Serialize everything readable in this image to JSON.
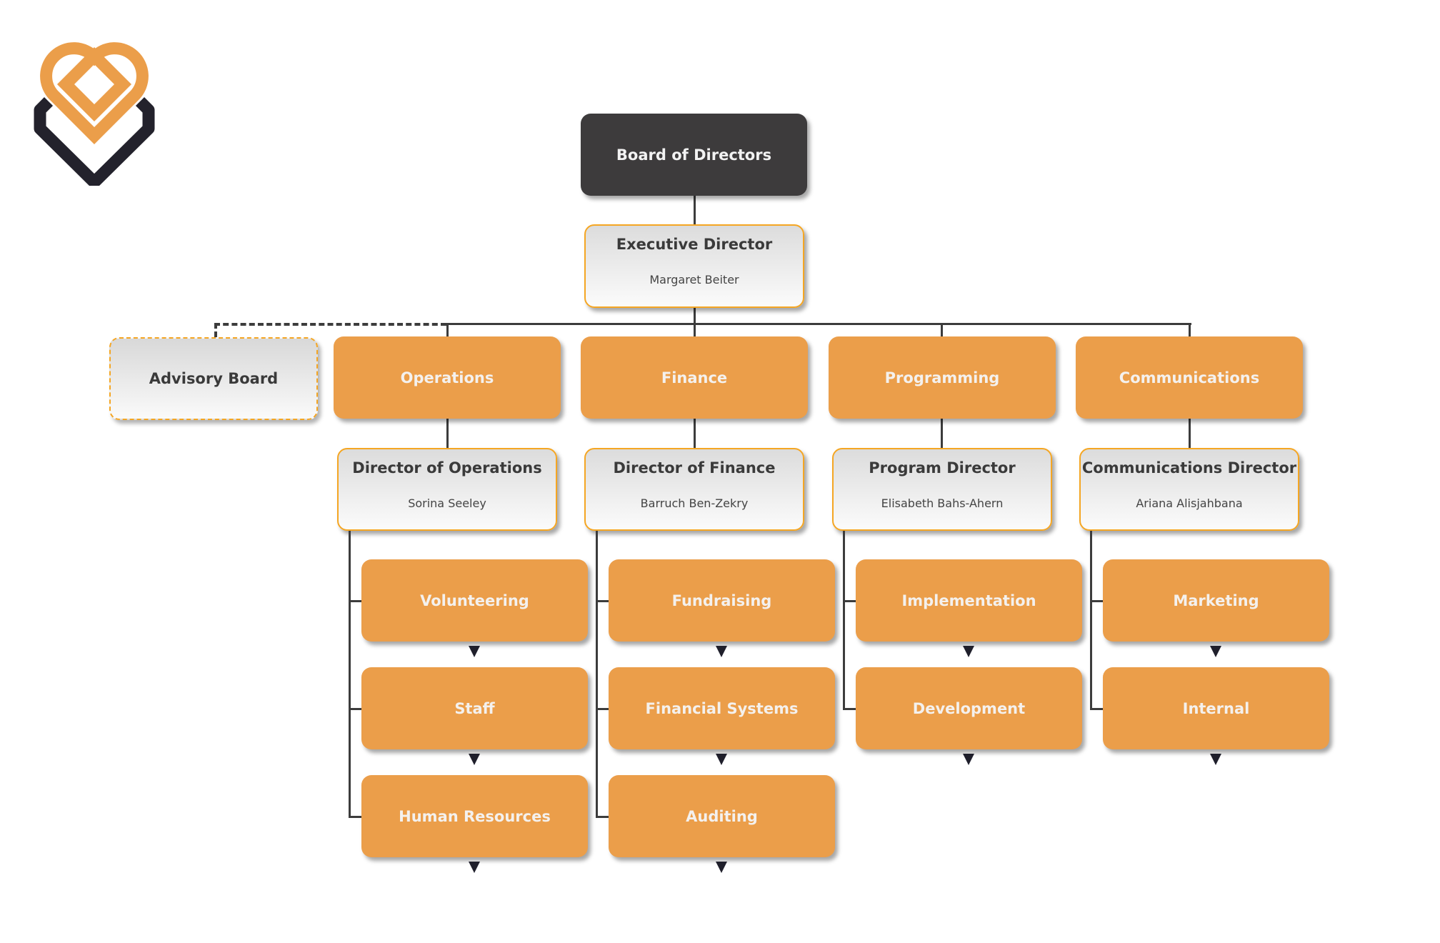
{
  "brand": {
    "logo": "heart-diamond-logo-icon",
    "accent": "#eb9e4a",
    "dark": "#3d3b3c",
    "outline": "#f5a623"
  },
  "board": {
    "label": "Board of Directors"
  },
  "executive": {
    "title": "Executive Director",
    "name": "Margaret Beiter"
  },
  "advisory": {
    "label": "Advisory Board"
  },
  "departments": [
    {
      "label": "Operations",
      "director": {
        "title": "Director of Operations",
        "name": "Sorina Seeley"
      },
      "units": [
        "Volunteering",
        "Staff",
        "Human Resources"
      ]
    },
    {
      "label": "Finance",
      "director": {
        "title": "Director of Finance",
        "name": "Barruch Ben-Zekry"
      },
      "units": [
        "Fundraising",
        "Financial Systems",
        "Auditing"
      ]
    },
    {
      "label": "Programming",
      "director": {
        "title": "Program Director",
        "name": "Elisabeth Bahs-Ahern"
      },
      "units": [
        "Implementation",
        "Development"
      ]
    },
    {
      "label": "Communications",
      "director": {
        "title": "Communications Director",
        "name": "Ariana Alisjahbana"
      },
      "units": [
        "Marketing",
        "Internal"
      ]
    }
  ]
}
